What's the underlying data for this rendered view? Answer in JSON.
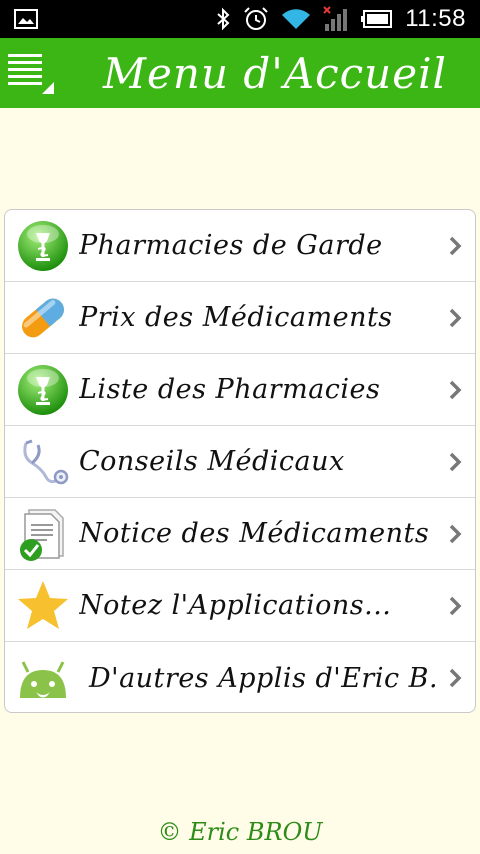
{
  "status_bar": {
    "time": "11:58",
    "icons": [
      "image-icon",
      "bluetooth-icon",
      "alarm-icon",
      "wifi-icon",
      "signal-icon",
      "battery-icon"
    ]
  },
  "action_bar": {
    "title": "Menu d'Accueil",
    "menu_icon": "list-menu-icon",
    "background_color": "#3cb615"
  },
  "menu": {
    "items": [
      {
        "label": "Pharmacies de Garde",
        "icon": "pharmacy-icon"
      },
      {
        "label": "Prix des Médicaments",
        "icon": "pill-icon"
      },
      {
        "label": "Liste des Pharmacies",
        "icon": "pharmacy-icon"
      },
      {
        "label": "Conseils Médicaux",
        "icon": "stethoscope-icon"
      },
      {
        "label": "Notice des Médicaments",
        "icon": "document-check-icon"
      },
      {
        "label": "Notez l'Applications...",
        "icon": "star-icon"
      },
      {
        "label": "D'autres Applis d'Eric B...",
        "icon": "android-icon"
      }
    ]
  },
  "footer": {
    "text": "© Eric BROU",
    "color": "#2e8b1a"
  },
  "colors": {
    "background": "#fffde7",
    "accent": "#3cb615"
  }
}
